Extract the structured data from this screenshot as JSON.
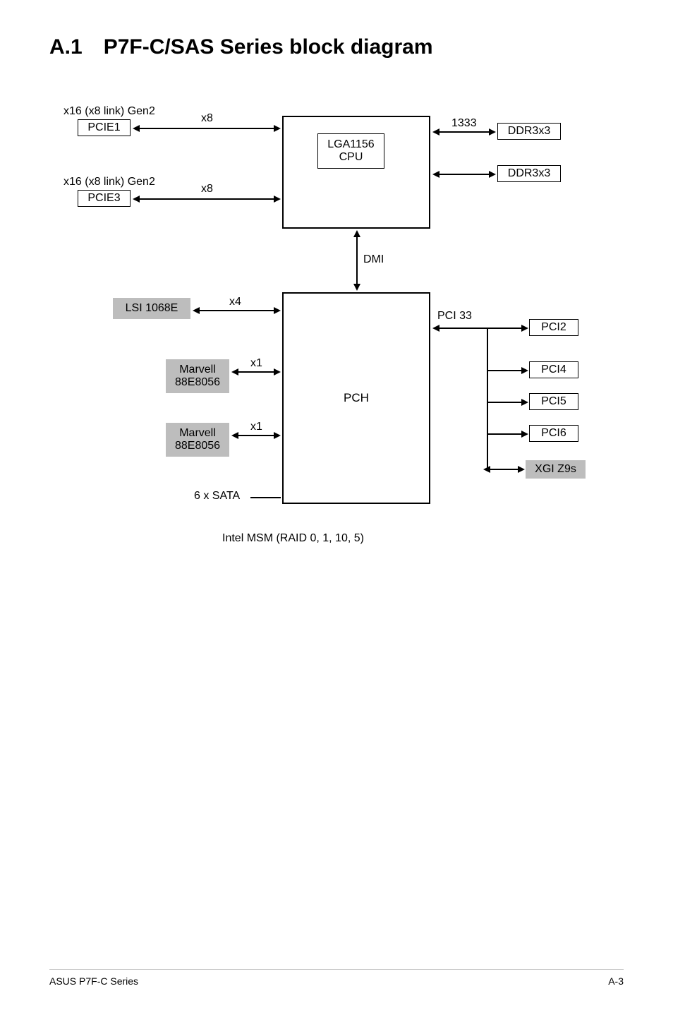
{
  "header": {
    "section_number": "A.1",
    "section_title": "P7F-C/SAS Series block diagram"
  },
  "labels": {
    "pcie1_desc": "x16 (x8 link) Gen2",
    "pcie3_desc": "x16 (x8 link) Gen2",
    "pcie1": "PCIE1",
    "pcie3": "PCIE3",
    "x8_a": "x8",
    "x8_b": "x8",
    "cpu": "LGA1156\nCPU",
    "speed1333": "1333",
    "ddr3_a": "DDR3x3",
    "ddr3_b": "DDR3x3",
    "dmi": "DMI",
    "lsi": "LSI 1068E",
    "x4": "x4",
    "marvell_a": "Marvell\n88E8056",
    "marvell_b": "Marvell\n88E8056",
    "x1_a": "x1",
    "x1_b": "x1",
    "pch": "PCH",
    "pci33": "PCI 33",
    "pci2": "PCI2",
    "pci4": "PCI4",
    "pci5": "PCI5",
    "pci6": "PCI6",
    "xgi": "XGI Z9s",
    "sata": "6 x SATA",
    "raid": "Intel MSM (RAID 0, 1, 10, 5)"
  },
  "footer": {
    "left": "ASUS P7F-C Series",
    "right": "A-3"
  }
}
